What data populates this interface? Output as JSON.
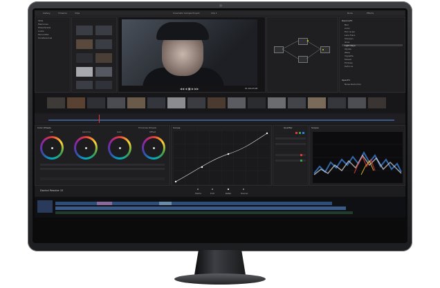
{
  "header": {
    "left_items": [
      "Gallery",
      "Timeline",
      "Clips"
    ],
    "project_title": "Cinematic Sample Project",
    "viewer_title": "Clip 1",
    "right_items": [
      "Node",
      "Effects"
    ]
  },
  "gallery": {
    "albums": [
      "Stills",
      "Memories",
      "PowerGrade",
      "Looks",
      "Favourites",
      "Unreferenced"
    ]
  },
  "viewer": {
    "timecode": "01:00:23:08"
  },
  "effects": {
    "header": "ResolveFX",
    "items": [
      "Blur",
      "Color",
      "Film Grain",
      "Lens Flare",
      "Sharpen",
      "Glow",
      "Light Rays",
      "Stylize",
      "Warp",
      "Vignette",
      "Mosaic",
      "Emboss",
      "Defocus"
    ],
    "footer_header": "OpenFX",
    "footer_items": [
      "Noise Reduction"
    ]
  },
  "color_panel": {
    "title": "Color Wheels",
    "wheels": [
      {
        "label": "Lift"
      },
      {
        "label": "Gamma"
      },
      {
        "label": "Gain"
      },
      {
        "label": "Offset"
      }
    ],
    "primaries_label": "Primaries Wheels",
    "curves_title": "Curves",
    "keyer_title": "Qualifier",
    "scope_title": "Scopes"
  },
  "bottom_tabs": [
    "Media",
    "Edit",
    "Color",
    "Deliver"
  ],
  "bottom_tab_active": "Color",
  "timeline_label": "Davinci Resolve 15",
  "colors": {
    "accent_red": "#e53935",
    "bg": "#1b1b1d"
  }
}
